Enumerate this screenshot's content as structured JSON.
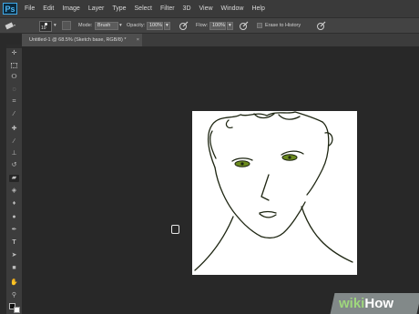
{
  "app": {
    "logo": "Ps"
  },
  "menu": [
    "File",
    "Edit",
    "Image",
    "Layer",
    "Type",
    "Select",
    "Filter",
    "3D",
    "View",
    "Window",
    "Help"
  ],
  "options": {
    "brush_size": "10",
    "mode_label": "Mode:",
    "mode_value": "Brush",
    "opacity_label": "Opacity:",
    "opacity_value": "100%",
    "flow_label": "Flow:",
    "flow_value": "100%",
    "erase_history_label": "Erase to History"
  },
  "document_tab": {
    "title": "Untitled-1 @ 68.5% (Sketch base, RGB/8) *"
  },
  "tools": [
    "move-tool-icon",
    "marquee-tool-icon",
    "lasso-tool-icon",
    "quick-select-tool-icon",
    "crop-tool-icon",
    "eyedropper-tool-icon",
    "healing-brush-tool-icon",
    "brush-tool-icon",
    "clone-stamp-tool-icon",
    "history-brush-tool-icon",
    "eraser-tool-icon",
    "gradient-tool-icon",
    "blur-tool-icon",
    "dodge-tool-icon",
    "pen-tool-icon",
    "type-tool-icon",
    "path-select-tool-icon",
    "shape-tool-icon",
    "hand-tool-icon",
    "zoom-tool-icon"
  ],
  "watermark": {
    "part1": "wiki",
    "part2": "How"
  },
  "colors": {
    "accent": "#3fa9e8",
    "sketch_stroke": "#1e2612",
    "eye": "#6a8a1e"
  }
}
